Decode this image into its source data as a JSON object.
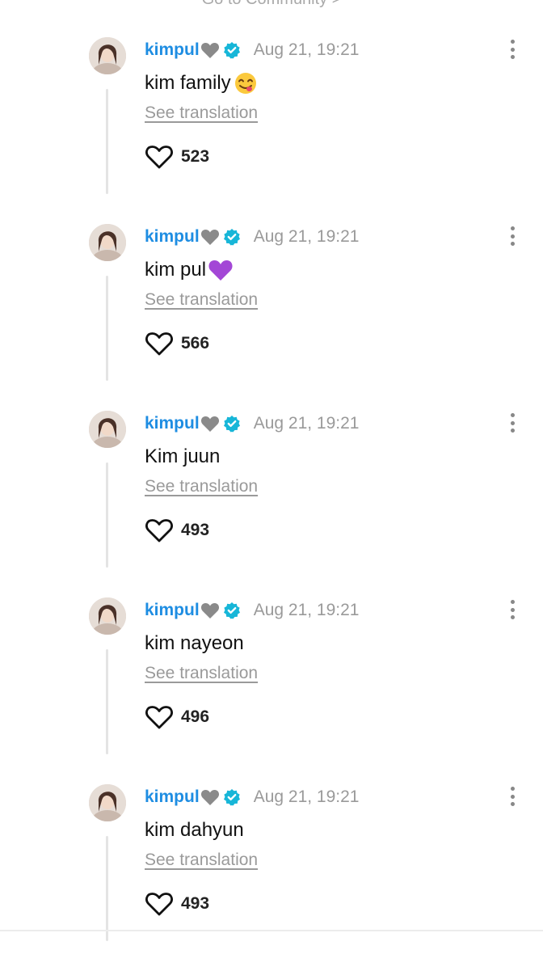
{
  "top_link": {
    "label": "Go to Community >"
  },
  "comments": [
    {
      "author": "kimpul",
      "time": "Aug 21, 19:21",
      "text": "kim family",
      "emoji": "savoring-food-emoji",
      "translate": "See translation",
      "likes": "523"
    },
    {
      "author": "kimpul",
      "time": "Aug 21, 19:21",
      "text": "kim pul",
      "emoji": "purple-heart-emoji",
      "translate": "See translation",
      "likes": "566"
    },
    {
      "author": "kimpul",
      "time": "Aug 21, 19:21",
      "text": "Kim juun",
      "emoji": "",
      "translate": "See translation",
      "likes": "493"
    },
    {
      "author": "kimpul",
      "time": "Aug 21, 19:21",
      "text": "kim nayeon",
      "emoji": "",
      "translate": "See translation",
      "likes": "496"
    },
    {
      "author": "kimpul",
      "time": "Aug 21, 19:21",
      "text": "kim dahyun",
      "emoji": "",
      "translate": "See translation",
      "likes": "493"
    }
  ],
  "colors": {
    "author": "#1e8de2",
    "verified_badge": "#17b6d8",
    "timestamp": "#9a9a9a",
    "thread_line": "#e4e4e4"
  },
  "icons": {
    "author_suffix": "gray-heart-icon",
    "badge": "verified-badge-icon",
    "like": "heart-outline-icon",
    "menu": "more-vertical-icon"
  }
}
